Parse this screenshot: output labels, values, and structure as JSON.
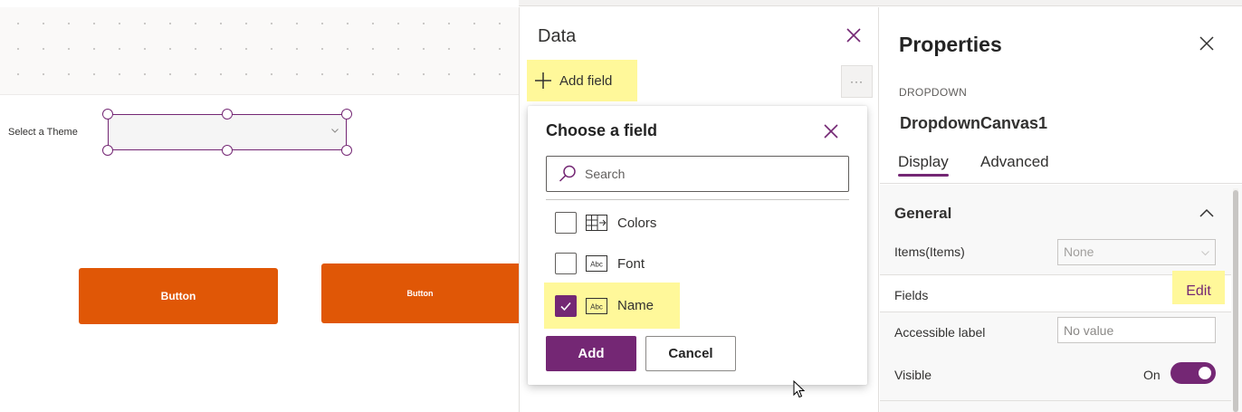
{
  "canvas": {
    "theme_label": "Select a Theme",
    "button1_label": "Button",
    "button2_label": "Button",
    "accent_color": "#E05706"
  },
  "data_panel": {
    "title": "Data",
    "add_field_label": "Add field",
    "more_label": "···"
  },
  "choose_field": {
    "title": "Choose a field",
    "search_placeholder": "Search",
    "fields": [
      {
        "label": "Colors",
        "icon": "table-icon",
        "checked": false
      },
      {
        "label": "Font",
        "icon": "text-field-icon",
        "checked": false
      },
      {
        "label": "Name",
        "icon": "text-field-icon",
        "checked": true
      }
    ],
    "add_label": "Add",
    "cancel_label": "Cancel"
  },
  "properties": {
    "title": "Properties",
    "control_type": "DROPDOWN",
    "control_name": "DropdownCanvas1",
    "tabs": [
      "Display",
      "Advanced"
    ],
    "section": "General",
    "items_label": "Items(Items)",
    "items_value": "None",
    "fields_label": "Fields",
    "edit_label": "Edit",
    "accessible_label": "Accessible label",
    "accessible_placeholder": "No value",
    "visible_label": "Visible",
    "visible_state": "On",
    "brand_color": "#742774"
  }
}
